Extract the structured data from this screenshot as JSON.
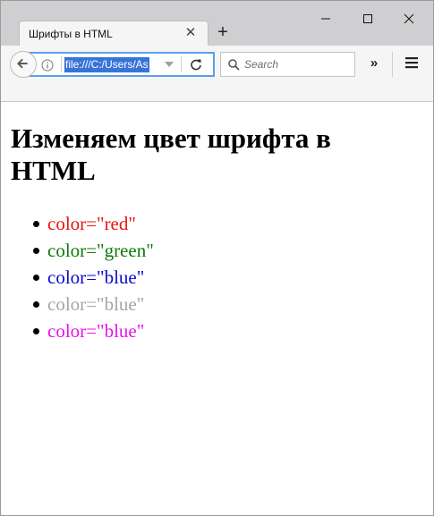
{
  "browser": {
    "tab_title": "Шрифты в HTML",
    "url": "file:///C:/Users/As",
    "search_placeholder": "Search"
  },
  "page": {
    "heading": "Изменяем цвет шрифта в HTML",
    "items": [
      {
        "text": "color=\"red\"",
        "color": "#e8140c"
      },
      {
        "text": "color=\"green\"",
        "color": "#0c7a0c"
      },
      {
        "text": "color=\"blue\"",
        "color": "#0a0ad2"
      },
      {
        "text": "color=\"blue\"",
        "color": "#a5a5a5"
      },
      {
        "text": "color=\"blue\"",
        "color": "#e812e8"
      }
    ]
  },
  "icons": {
    "tab_close": "close-icon",
    "new_tab": "plus-icon",
    "minimize": "minimize-icon",
    "maximize": "maximize-icon",
    "close": "close-icon",
    "back": "back-arrow-icon",
    "info": "info-icon",
    "dropdown": "chevron-down-icon",
    "reload": "reload-icon",
    "search": "search-icon",
    "overflow": "double-chevron-icon",
    "menu": "hamburger-menu-icon"
  }
}
